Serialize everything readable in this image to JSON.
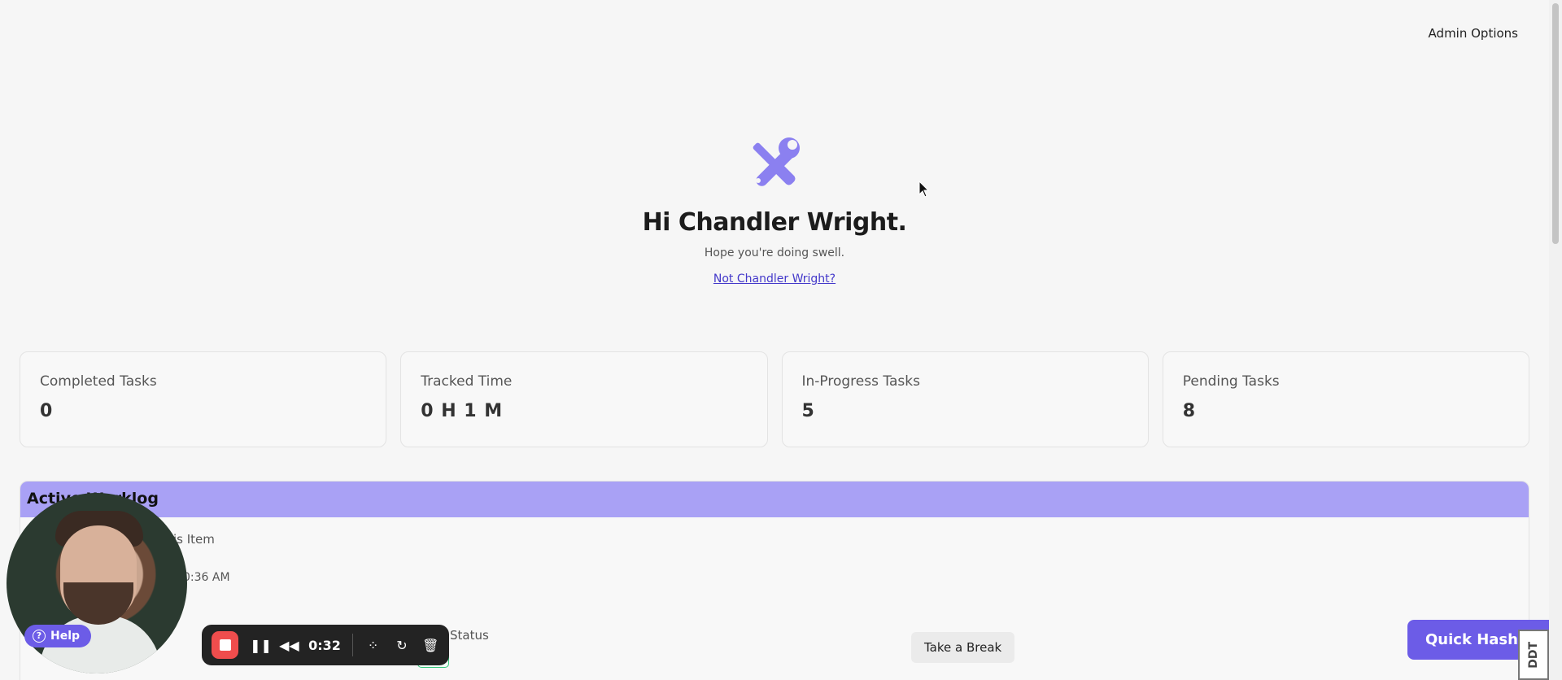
{
  "header": {
    "admin_options": "Admin Options"
  },
  "hero": {
    "greeting": "Hi Chandler Wright.",
    "subtitle": "Hope you're doing swell.",
    "not_user_link": "Not Chandler Wright?",
    "logo_icon": "tools-icon",
    "accent_color": "#8b80f0"
  },
  "stats": [
    {
      "label": "Completed Tasks",
      "value": "0"
    },
    {
      "label": "Tracked Time",
      "value": "0 H 1 M"
    },
    {
      "label": "In-Progress Tasks",
      "value": "5"
    },
    {
      "label": "Pending Tasks",
      "value": "8"
    }
  ],
  "worklog": {
    "title": "Active Worklog",
    "item_label": "is Item",
    "time_value": "0:36 AM",
    "status_label": "Status",
    "status_badge": "ve",
    "header_color": "#a9a1f5"
  },
  "help": {
    "label": "Help"
  },
  "recorder": {
    "time": "0:32",
    "stop_color": "#ef4d4d"
  },
  "actions": {
    "take_break": "Take a Break",
    "quick_hash": "Quick Hash In",
    "ddt_badge": "DDT"
  }
}
